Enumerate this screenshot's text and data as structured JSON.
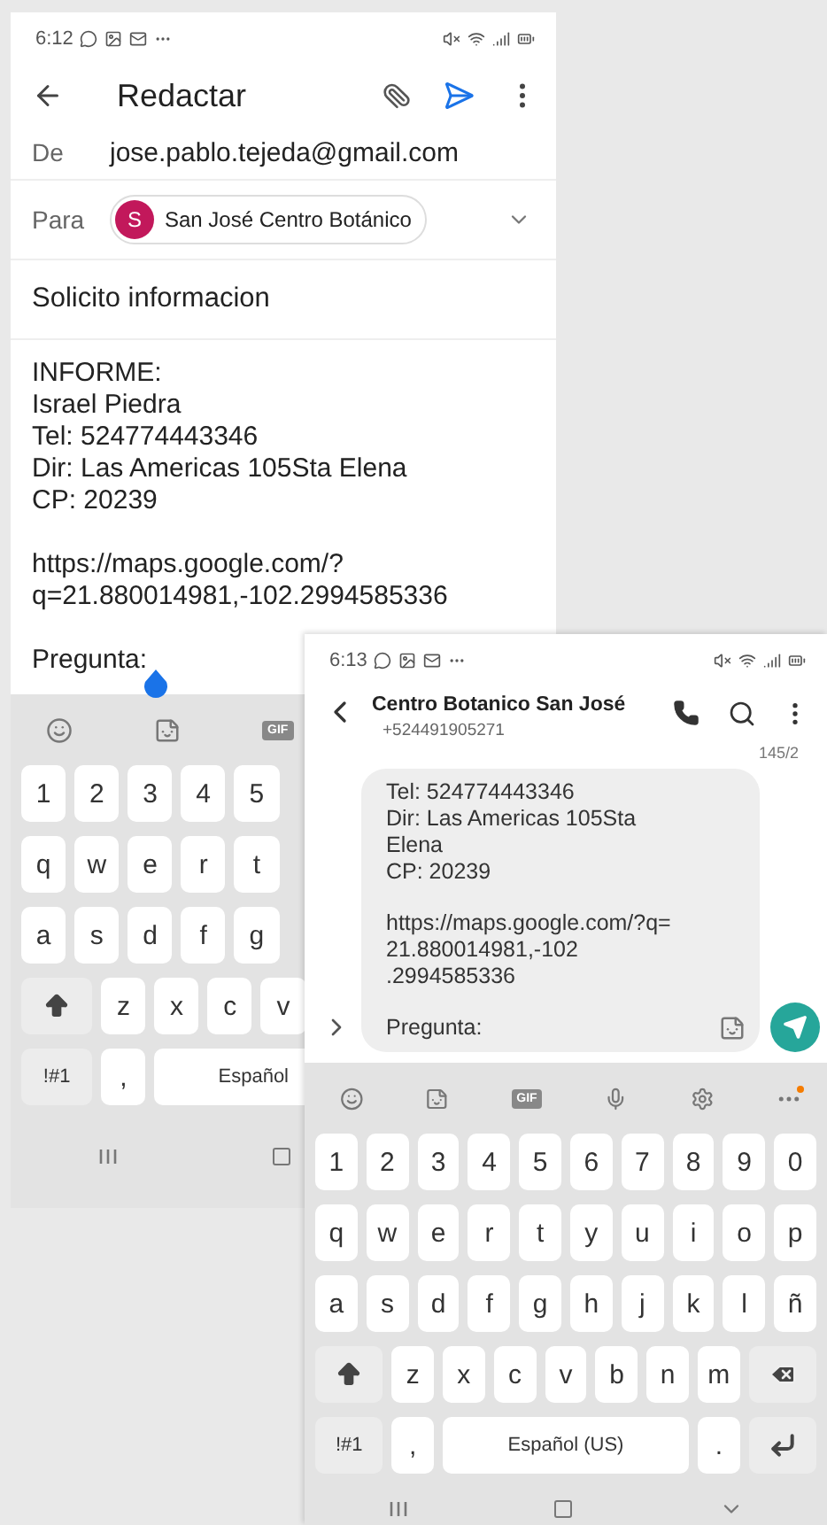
{
  "email_app": {
    "status_bar": {
      "time": "6:12"
    },
    "title": "Redactar",
    "from": {
      "label": "De",
      "value": "jose.pablo.tejeda@gmail.com"
    },
    "to": {
      "label": "Para",
      "recipients": [
        {
          "initial": "S",
          "name": "San José Centro Botánico",
          "color": "#c2185b"
        }
      ]
    },
    "subject": "Solicito informacion",
    "body": [
      "INFORME:\nIsrael Piedra\nTel: 524774443346\nDir: Las Americas 105Sta Elena\nCP: 20239",
      "https://maps.google.com/?\nq=21.880014981,-102.2994585336",
      "Pregunta:"
    ],
    "keyboard": {
      "toolbar": [
        {
          "kind": "emoji"
        },
        {
          "kind": "sticker"
        },
        {
          "kind": "gif",
          "label": "GIF"
        }
      ],
      "rows": [
        [
          {
            "kind": "char",
            "label": "1"
          },
          {
            "kind": "char",
            "label": "2"
          },
          {
            "kind": "char",
            "label": "3"
          },
          {
            "kind": "char",
            "label": "4"
          },
          {
            "kind": "char",
            "label": "5"
          }
        ],
        [
          {
            "kind": "char",
            "label": "q"
          },
          {
            "kind": "char",
            "label": "w"
          },
          {
            "kind": "char",
            "label": "e"
          },
          {
            "kind": "char",
            "label": "r"
          },
          {
            "kind": "char",
            "label": "t"
          }
        ],
        [
          {
            "kind": "char",
            "label": "a"
          },
          {
            "kind": "char",
            "label": "s"
          },
          {
            "kind": "char",
            "label": "d"
          },
          {
            "kind": "char",
            "label": "f"
          },
          {
            "kind": "char",
            "label": "g"
          }
        ],
        [
          {
            "kind": "shift"
          },
          {
            "kind": "char",
            "label": "z"
          },
          {
            "kind": "char",
            "label": "x"
          },
          {
            "kind": "char",
            "label": "c"
          },
          {
            "kind": "char",
            "label": "v"
          }
        ]
      ],
      "bottom_row": [
        {
          "kind": "symbols",
          "label": "!#1"
        },
        {
          "kind": "char",
          "label": ","
        },
        {
          "kind": "space",
          "label": "Español"
        }
      ]
    }
  },
  "sms_app": {
    "status_bar": {
      "time": "6:13"
    },
    "contact": {
      "name": "Centro Botanico San José",
      "number": "+524491905271"
    },
    "counter": "145/2",
    "message": [
      "Tel: 524774443346\nDir: Las Americas 105Sta\nElena\nCP: 20239",
      "https://maps.google.com/?q=\n21.880014981,-102\n.2994585336",
      "Pregunta:"
    ],
    "keyboard": {
      "toolbar": [
        {
          "kind": "emoji"
        },
        {
          "kind": "sticker"
        },
        {
          "kind": "gif",
          "label": "GIF"
        },
        {
          "kind": "mic"
        },
        {
          "kind": "settings"
        },
        {
          "kind": "more"
        }
      ],
      "rows": [
        [
          {
            "kind": "char",
            "label": "1"
          },
          {
            "kind": "char",
            "label": "2"
          },
          {
            "kind": "char",
            "label": "3"
          },
          {
            "kind": "char",
            "label": "4"
          },
          {
            "kind": "char",
            "label": "5"
          },
          {
            "kind": "char",
            "label": "6"
          },
          {
            "kind": "char",
            "label": "7"
          },
          {
            "kind": "char",
            "label": "8"
          },
          {
            "kind": "char",
            "label": "9"
          },
          {
            "kind": "char",
            "label": "0"
          }
        ],
        [
          {
            "kind": "char",
            "label": "q"
          },
          {
            "kind": "char",
            "label": "w"
          },
          {
            "kind": "char",
            "label": "e"
          },
          {
            "kind": "char",
            "label": "r"
          },
          {
            "kind": "char",
            "label": "t"
          },
          {
            "kind": "char",
            "label": "y"
          },
          {
            "kind": "char",
            "label": "u"
          },
          {
            "kind": "char",
            "label": "i"
          },
          {
            "kind": "char",
            "label": "o"
          },
          {
            "kind": "char",
            "label": "p"
          }
        ],
        [
          {
            "kind": "char",
            "label": "a"
          },
          {
            "kind": "char",
            "label": "s"
          },
          {
            "kind": "char",
            "label": "d"
          },
          {
            "kind": "char",
            "label": "f"
          },
          {
            "kind": "char",
            "label": "g"
          },
          {
            "kind": "char",
            "label": "h"
          },
          {
            "kind": "char",
            "label": "j"
          },
          {
            "kind": "char",
            "label": "k"
          },
          {
            "kind": "char",
            "label": "l"
          },
          {
            "kind": "char",
            "label": "ñ"
          }
        ],
        [
          {
            "kind": "shift"
          },
          {
            "kind": "char",
            "label": "z"
          },
          {
            "kind": "char",
            "label": "x"
          },
          {
            "kind": "char",
            "label": "c"
          },
          {
            "kind": "char",
            "label": "v"
          },
          {
            "kind": "char",
            "label": "b"
          },
          {
            "kind": "char",
            "label": "n"
          },
          {
            "kind": "char",
            "label": "m"
          },
          {
            "kind": "backspace"
          }
        ]
      ],
      "bottom_row": [
        {
          "kind": "symbols",
          "label": "!#1"
        },
        {
          "kind": "char",
          "label": ","
        },
        {
          "kind": "space",
          "label": "Español (US)"
        },
        {
          "kind": "char",
          "label": "."
        },
        {
          "kind": "enter"
        }
      ]
    }
  }
}
